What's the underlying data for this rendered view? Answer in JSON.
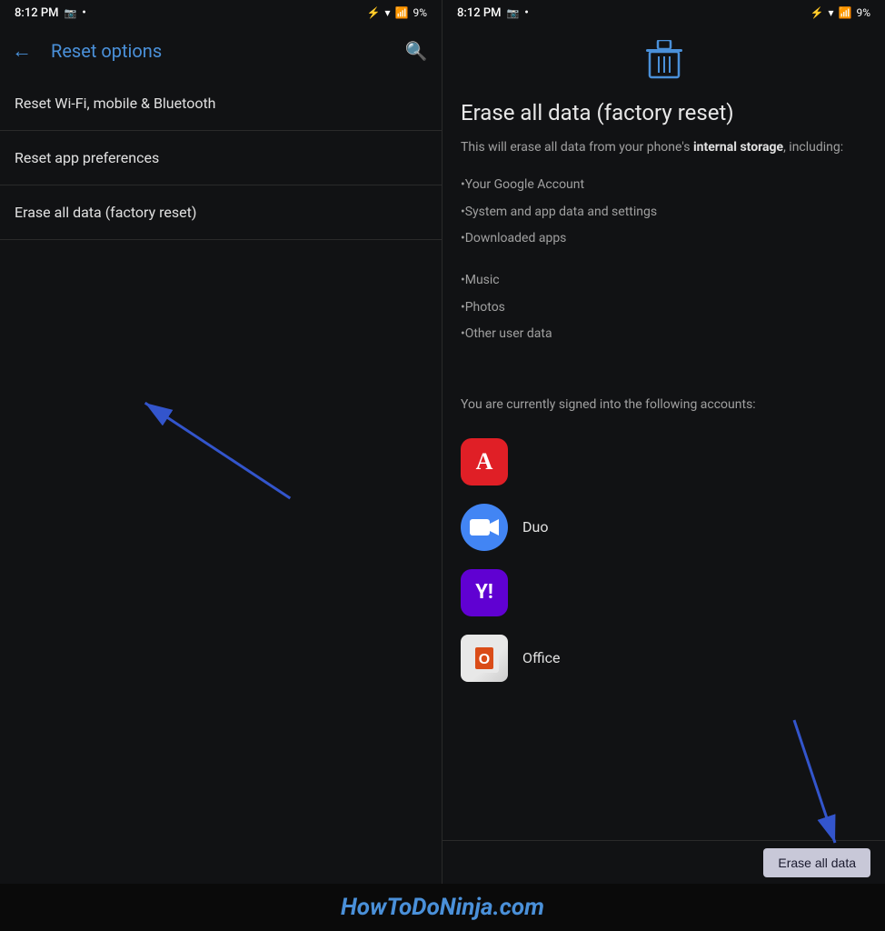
{
  "left": {
    "status": {
      "time": "8:12 PM",
      "battery": "9%"
    },
    "toolbar": {
      "back_label": "←",
      "title": "Reset options",
      "search_label": "🔍"
    },
    "menu_items": [
      {
        "id": "wifi",
        "label": "Reset Wi-Fi, mobile & Bluetooth"
      },
      {
        "id": "app_prefs",
        "label": "Reset app preferences"
      },
      {
        "id": "factory",
        "label": "Erase all data (factory reset)"
      }
    ]
  },
  "right": {
    "status": {
      "time": "8:12 PM",
      "battery": "9%"
    },
    "trash_icon": "🗑",
    "title": "Erase all data (factory reset)",
    "description_plain": "This will erase all data from your phone's ",
    "description_bold": "internal storage",
    "description_end": ", including:",
    "bullets": [
      "•Your Google Account",
      "•System and app data and settings",
      "•Downloaded apps",
      "•Music",
      "•Photos",
      "•Other user data"
    ],
    "signed_in_text": "You are currently signed into the following accounts:",
    "accounts": [
      {
        "id": "adobe",
        "label": "",
        "type": "adobe"
      },
      {
        "id": "duo",
        "label": "Duo",
        "type": "duo"
      },
      {
        "id": "yahoo",
        "label": "",
        "type": "yahoo"
      },
      {
        "id": "office",
        "label": "Office",
        "type": "office"
      }
    ],
    "erase_button_label": "Erase all data"
  },
  "watermark": "HowToDoNinja.com"
}
